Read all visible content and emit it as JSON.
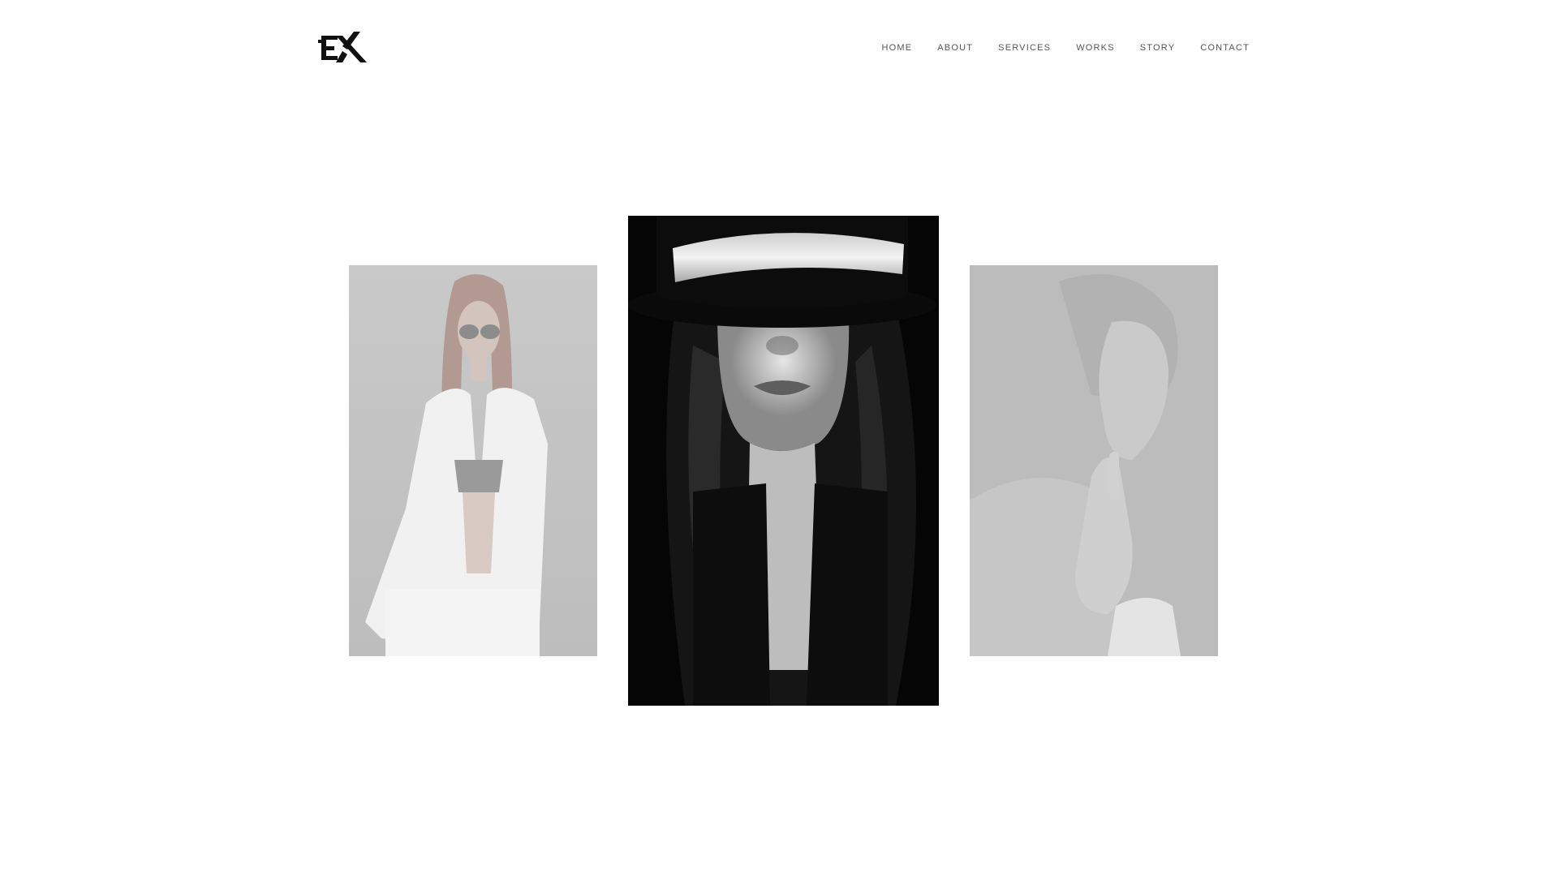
{
  "brand": {
    "logo_text": "EX",
    "logo_icon": "ex-logo-icon"
  },
  "nav": {
    "items": [
      "HOME",
      "ABOUT",
      "SERVICES",
      "WORKS",
      "STORY",
      "CONTACT"
    ]
  },
  "colors": {
    "background": "#ffffff",
    "nav_text": "#555555",
    "logo": "#111111",
    "faded_overlay": "#c8c8c8"
  },
  "slider": {
    "slides": [
      {
        "name": "woman-in-white-suit-photo",
        "state": "inactive"
      },
      {
        "name": "woman-in-black-hat-photo",
        "state": "active"
      },
      {
        "name": "woman-finger-on-lips-photo",
        "state": "inactive"
      }
    ]
  }
}
